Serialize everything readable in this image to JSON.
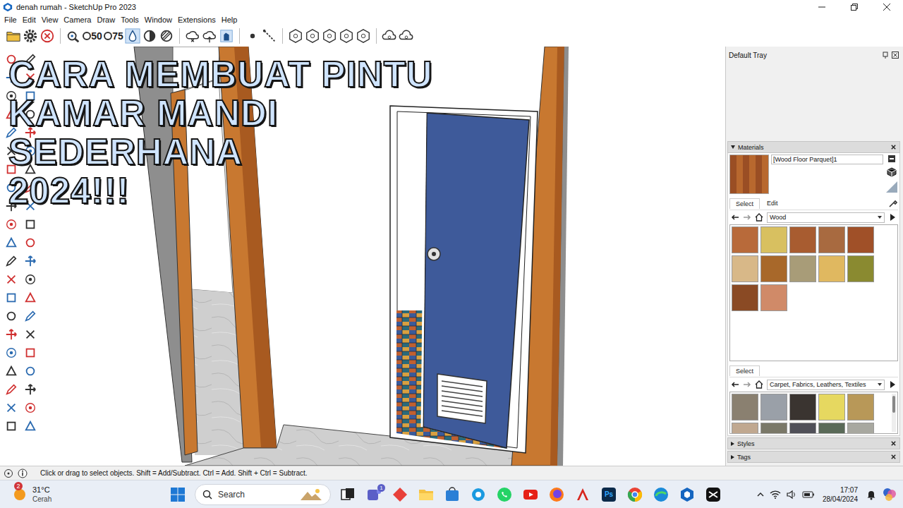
{
  "window": {
    "title": "denah rumah - SketchUp Pro 2023"
  },
  "menu": [
    "File",
    "Edit",
    "View",
    "Camera",
    "Draw",
    "Tools",
    "Window",
    "Extensions",
    "Help"
  ],
  "toolbar": {
    "presets": [
      "50",
      "75"
    ]
  },
  "overlay": {
    "lines": [
      "CARA MEMBUAT PINTU",
      "KAMAR MANDI",
      "SEDERHANA",
      "2024!!!"
    ]
  },
  "tray": {
    "title": "Default Tray",
    "materials": {
      "title": "Materials",
      "expanded": true,
      "current": "[Wood Floor Parquet]1",
      "tabs": [
        {
          "label": "Select",
          "selected": true
        },
        {
          "label": "Edit",
          "selected": false
        }
      ],
      "library": "Wood",
      "swatches": [
        {
          "color": "#b86a3a"
        },
        {
          "color": "#d8c060"
        },
        {
          "color": "#a85c30"
        },
        {
          "color": "#a86a40"
        },
        {
          "color": "#a05028"
        },
        {
          "color": "#d8b888"
        },
        {
          "color": "#a8682a"
        },
        {
          "color": "#a89c78"
        },
        {
          "color": "#e0b860"
        },
        {
          "color": "#8a8a30"
        },
        {
          "color": "#8a4a24"
        },
        {
          "color": "#d08a68"
        }
      ],
      "secondary": {
        "tab": "Select",
        "library": "Carpet, Fabrics, Leathers, Textiles",
        "swatches": [
          {
            "color": "#8a8070"
          },
          {
            "color": "#9aa0a8"
          },
          {
            "color": "#3a3430"
          },
          {
            "color": "#e6d860"
          },
          {
            "color": "#b89858"
          },
          {
            "color": "#c0a890"
          },
          {
            "color": "#7a7868"
          },
          {
            "color": "#505058"
          },
          {
            "color": "#5a6a58"
          },
          {
            "color": "#a8a8a0"
          }
        ]
      }
    },
    "panels": [
      {
        "label": "Styles",
        "expanded": false
      },
      {
        "label": "Tags",
        "expanded": false
      }
    ]
  },
  "status_bar": {
    "text": "Click or drag to select objects. Shift = Add/Subtract. Ctrl = Add. Shift + Ctrl = Subtract."
  },
  "taskbar": {
    "weather": {
      "temperature": "31°C",
      "condition": "Cerah",
      "badge": "2"
    },
    "search": {
      "placeholder": "Search"
    },
    "teams_badge": "1",
    "photoshop_label": "Ps",
    "clock": {
      "time": "17:07",
      "date": "28/04/2024"
    }
  }
}
